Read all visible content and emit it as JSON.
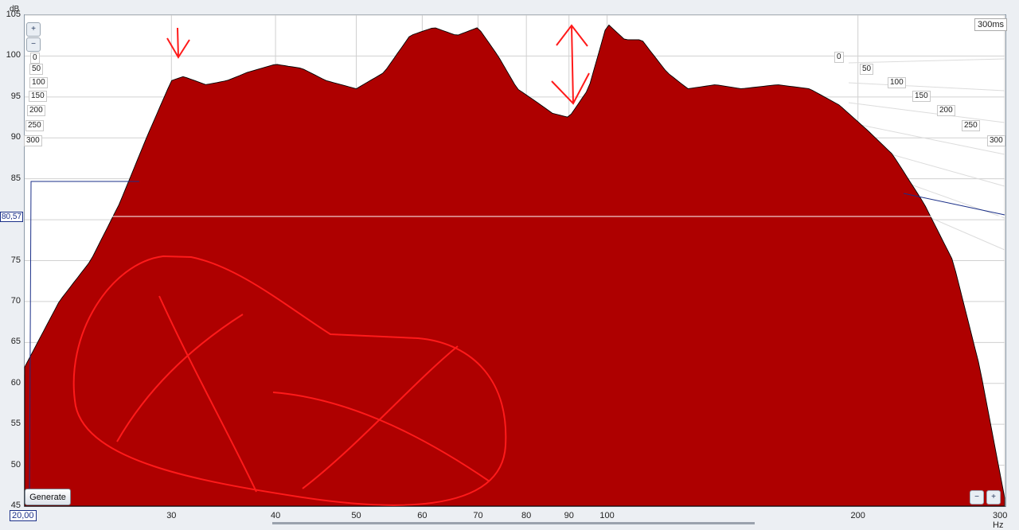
{
  "chart_data": {
    "type": "area",
    "title": "",
    "xlabel": "Hz",
    "ylabel": "dB",
    "x_scale": "log",
    "xlim": [
      20,
      300
    ],
    "ylim": [
      45,
      105
    ],
    "y_ticks": [
      105,
      100,
      95,
      90,
      85,
      80,
      75,
      70,
      65,
      60,
      55,
      50,
      45
    ],
    "x_ticks": [
      {
        "value": 30,
        "label": "30"
      },
      {
        "value": 40,
        "label": "40"
      },
      {
        "value": 50,
        "label": "50"
      },
      {
        "value": 60,
        "label": "60"
      },
      {
        "value": 70,
        "label": "70"
      },
      {
        "value": 80,
        "label": "80"
      },
      {
        "value": 90,
        "label": "90"
      },
      {
        "value": 100,
        "label": "100"
      },
      {
        "value": 200,
        "label": "200"
      },
      {
        "value": 300,
        "label": "300"
      }
    ],
    "x_unit": "Hz",
    "time_axis_unit": "300ms",
    "time_ticks": [
      "0",
      "50",
      "100",
      "150",
      "200",
      "250",
      "300"
    ],
    "cursor": {
      "level_db": "80,57",
      "freq_hz": "20,00"
    },
    "initial_response": {
      "x": [
        20,
        22,
        24,
        26,
        28,
        30,
        31,
        33,
        35,
        37,
        40,
        43,
        46,
        50,
        54,
        58,
        62,
        66,
        70,
        74,
        78,
        82,
        86,
        90,
        95,
        100,
        105,
        110,
        118,
        125,
        135,
        145,
        160,
        175,
        190,
        205,
        220,
        240,
        260,
        280,
        300
      ],
      "y": [
        62,
        70,
        75,
        82,
        90,
        97,
        97.5,
        96.5,
        97,
        98,
        99,
        98.5,
        97,
        96,
        98,
        102.5,
        103.5,
        102.5,
        103.5,
        100,
        96,
        94.5,
        93,
        92.5,
        96,
        104,
        102,
        102,
        98,
        96,
        96.5,
        96,
        96.5,
        96,
        94,
        91,
        88,
        82,
        75,
        62,
        46
      ]
    },
    "colors": {
      "fill": "#ae0000",
      "line": "#000000",
      "annotation": "#ff1a1a",
      "grid": "#d0d0d0",
      "cursor": "#1a2f88"
    }
  },
  "labels": {
    "db_unit": "dB",
    "hz_unit": "300 Hz",
    "ms_box": "300ms",
    "generate": "Generate",
    "zoom_in_icon": "+",
    "zoom_out_icon": "−"
  }
}
